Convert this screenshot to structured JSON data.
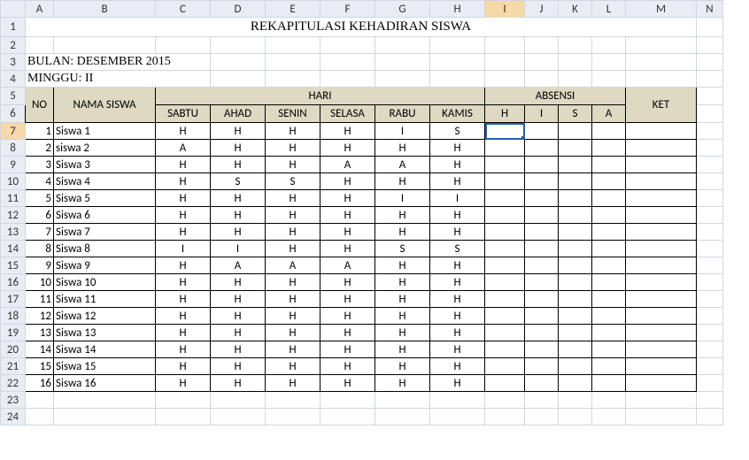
{
  "columns": [
    "A",
    "B",
    "C",
    "D",
    "E",
    "F",
    "G",
    "H",
    "I",
    "J",
    "K",
    "L",
    "M",
    "N"
  ],
  "col_widths": {
    "A": 32,
    "B": 115,
    "C": 62,
    "D": 62,
    "E": 62,
    "F": 62,
    "G": 62,
    "H": 62,
    "I": 45,
    "J": 38,
    "K": 38,
    "L": 38,
    "M": 80,
    "N": 30
  },
  "selected_col": "I",
  "title": "REKAPITULASI KEHADIRAN SISWA",
  "bulan": "BULAN: DESEMBER 2015",
  "minggu": "MINGGU: II",
  "header": {
    "no": "NO",
    "nama": "NAMA SISWA",
    "hari": "HARI",
    "absensi": "ABSENSI",
    "ket": "KET",
    "days": [
      "SABTU",
      "AHAD",
      "SENIN",
      "SELASA",
      "RABU",
      "KAMIS"
    ],
    "abs": [
      "H",
      "I",
      "S",
      "A"
    ]
  },
  "rows": [
    {
      "no": 1,
      "nama": "Siswa 1",
      "d": [
        "H",
        "H",
        "H",
        "H",
        "I",
        "S"
      ]
    },
    {
      "no": 2,
      "nama": "siswa 2",
      "d": [
        "A",
        "H",
        "H",
        "H",
        "H",
        "H"
      ]
    },
    {
      "no": 3,
      "nama": "Siswa 3",
      "d": [
        "H",
        "H",
        "H",
        "A",
        "A",
        "H"
      ]
    },
    {
      "no": 4,
      "nama": "Siswa 4",
      "d": [
        "H",
        "S",
        "S",
        "H",
        "H",
        "H"
      ]
    },
    {
      "no": 5,
      "nama": "Siswa 5",
      "d": [
        "H",
        "H",
        "H",
        "H",
        "I",
        "I"
      ]
    },
    {
      "no": 6,
      "nama": "Siswa 6",
      "d": [
        "H",
        "H",
        "H",
        "H",
        "H",
        "H"
      ]
    },
    {
      "no": 7,
      "nama": "Siswa 7",
      "d": [
        "H",
        "H",
        "H",
        "H",
        "H",
        "H"
      ]
    },
    {
      "no": 8,
      "nama": "Siswa 8",
      "d": [
        "I",
        "I",
        "H",
        "H",
        "S",
        "S"
      ]
    },
    {
      "no": 9,
      "nama": "Siswa 9",
      "d": [
        "H",
        "A",
        "A",
        "A",
        "H",
        "H"
      ]
    },
    {
      "no": 10,
      "nama": "Siswa 10",
      "d": [
        "H",
        "H",
        "H",
        "H",
        "H",
        "H"
      ]
    },
    {
      "no": 11,
      "nama": "Siswa 11",
      "d": [
        "H",
        "H",
        "H",
        "H",
        "H",
        "H"
      ]
    },
    {
      "no": 12,
      "nama": "Siswa 12",
      "d": [
        "H",
        "H",
        "H",
        "H",
        "H",
        "H"
      ]
    },
    {
      "no": 13,
      "nama": "Siswa 13",
      "d": [
        "H",
        "H",
        "H",
        "H",
        "H",
        "H"
      ]
    },
    {
      "no": 14,
      "nama": "Siswa 14",
      "d": [
        "H",
        "H",
        "H",
        "H",
        "H",
        "H"
      ]
    },
    {
      "no": 15,
      "nama": "Siswa 15",
      "d": [
        "H",
        "H",
        "H",
        "H",
        "H",
        "H"
      ]
    },
    {
      "no": 16,
      "nama": "Siswa 16",
      "d": [
        "H",
        "H",
        "H",
        "H",
        "H",
        "H"
      ]
    }
  ],
  "selected_cell": "I7"
}
